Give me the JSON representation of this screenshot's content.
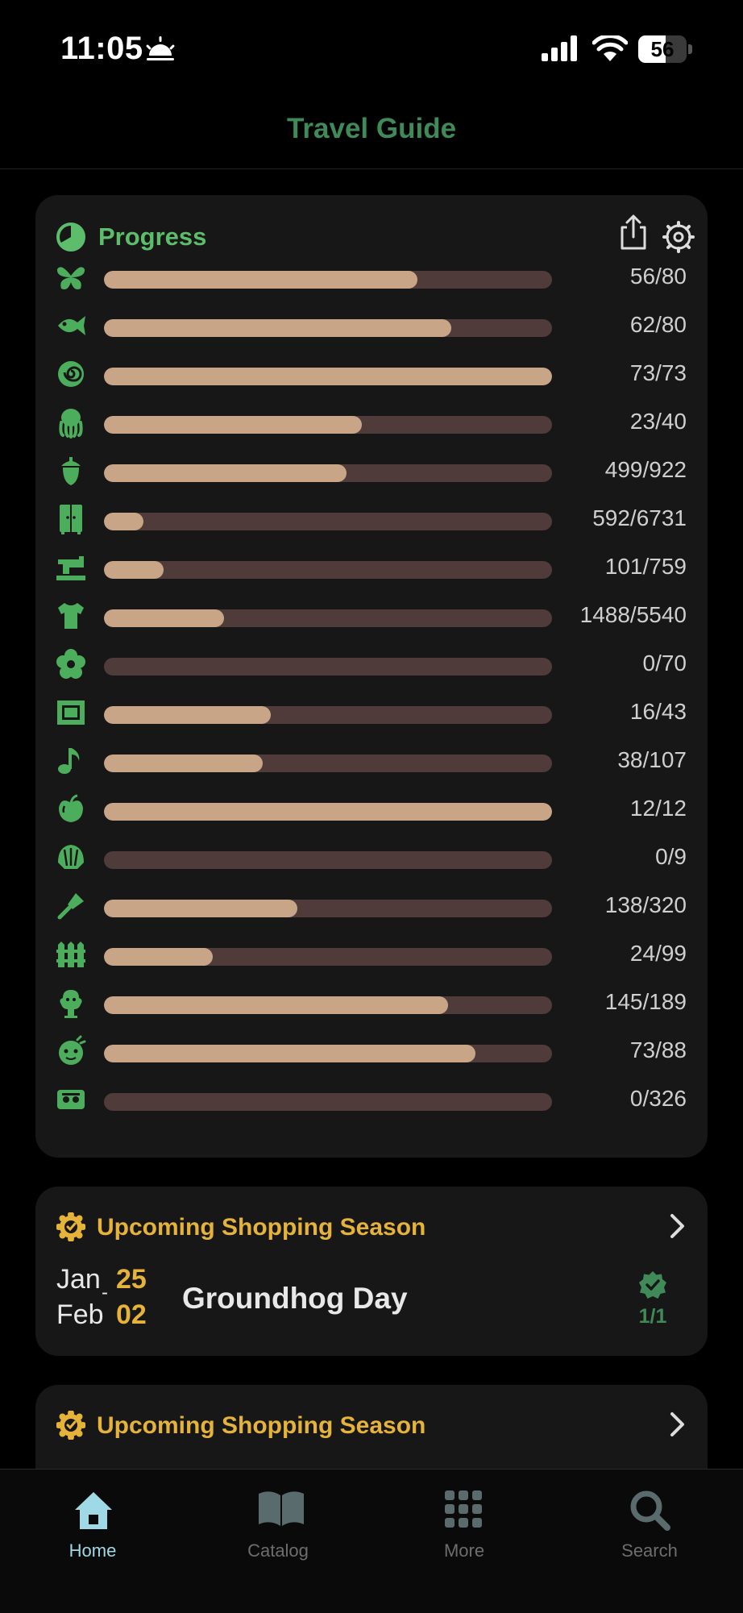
{
  "status_bar": {
    "time": "11:05",
    "battery": "56",
    "battery_level": 0.56
  },
  "nav": {
    "title": "Travel Guide"
  },
  "progress": {
    "title": "Progress",
    "rows": [
      {
        "icon": "butterfly-icon",
        "done": 56,
        "total": 80,
        "label": "56/80"
      },
      {
        "icon": "fish-icon",
        "done": 62,
        "total": 80,
        "label": "62/80"
      },
      {
        "icon": "spiral-shell-icon",
        "done": 73,
        "total": 73,
        "label": "73/73"
      },
      {
        "icon": "octopus-icon",
        "done": 23,
        "total": 40,
        "label": "23/40"
      },
      {
        "icon": "acorn-icon",
        "done": 499,
        "total": 922,
        "label": "499/922"
      },
      {
        "icon": "wardrobe-icon",
        "done": 592,
        "total": 6731,
        "label": "592/6731"
      },
      {
        "icon": "sewing-machine-icon",
        "done": 101,
        "total": 759,
        "label": "101/759"
      },
      {
        "icon": "shirt-icon",
        "done": 1488,
        "total": 5540,
        "label": "1488/5540"
      },
      {
        "icon": "flower-icon",
        "done": 0,
        "total": 70,
        "label": "0/70"
      },
      {
        "icon": "picture-frame-icon",
        "done": 16,
        "total": 43,
        "label": "16/43"
      },
      {
        "icon": "music-note-icon",
        "done": 38,
        "total": 107,
        "label": "38/107"
      },
      {
        "icon": "apple-icon",
        "done": 12,
        "total": 12,
        "label": "12/12"
      },
      {
        "icon": "scallop-icon",
        "done": 0,
        "total": 9,
        "label": "0/9"
      },
      {
        "icon": "shovel-icon",
        "done": 138,
        "total": 320,
        "label": "138/320"
      },
      {
        "icon": "fence-icon",
        "done": 24,
        "total": 99,
        "label": "24/99"
      },
      {
        "icon": "gyroid-icon",
        "done": 145,
        "total": 189,
        "label": "145/189"
      },
      {
        "icon": "villager-icon",
        "done": 73,
        "total": 88,
        "label": "73/88"
      },
      {
        "icon": "ticket-icon",
        "done": 0,
        "total": 326,
        "label": "0/326"
      }
    ]
  },
  "season1": {
    "title": "Upcoming Shopping Season",
    "start_month": "Jan",
    "start_day": "25",
    "end_month": "Feb",
    "end_day": "02",
    "event": "Groundhog Day",
    "count": "1/1"
  },
  "season2": {
    "title": "Upcoming Shopping Season"
  },
  "tabs": [
    {
      "label": "Home"
    },
    {
      "label": "Catalog"
    },
    {
      "label": "More"
    },
    {
      "label": "Search"
    }
  ],
  "colors": {
    "accent_green": "#5cbd6a",
    "title_green": "#3f8a58",
    "season_yellow": "#e6b33a",
    "bar_fill": "#c8a587",
    "bar_track": "#4f3b39",
    "tab_active": "#9fd9e6"
  }
}
